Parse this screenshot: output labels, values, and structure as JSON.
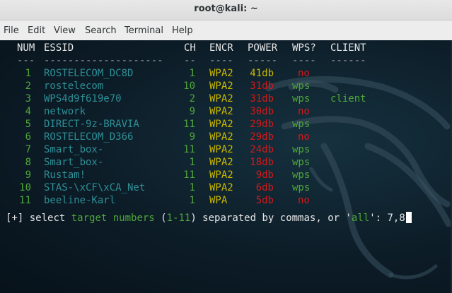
{
  "window": {
    "title": "root@kali: ~"
  },
  "menu": [
    "File",
    "Edit",
    "View",
    "Search",
    "Terminal",
    "Help"
  ],
  "table": {
    "headers": {
      "num": "NUM",
      "essid": "ESSID",
      "ch": "CH",
      "encr": "ENCR",
      "power": "POWER",
      "wps": "WPS?",
      "client": "CLIENT"
    },
    "separators": {
      "num": "---",
      "essid": "--------------------",
      "ch": "--",
      "encr": "----",
      "power": "-----",
      "wps": "----",
      "client": "------"
    },
    "rows": [
      {
        "num": "1",
        "essid": "ROSTELECOM_DC8D",
        "ch": "1",
        "encr": "WPA2",
        "power": "41db",
        "wps": "no",
        "client": ""
      },
      {
        "num": "2",
        "essid": "rostelecom",
        "ch": "10",
        "encr": "WPA2",
        "power": "31db",
        "wps": "wps",
        "client": ""
      },
      {
        "num": "3",
        "essid": "WPS4d9f619e70",
        "ch": "2",
        "encr": "WPA2",
        "power": "31db",
        "wps": "wps",
        "client": "client"
      },
      {
        "num": "4",
        "essid": "network",
        "ch": "9",
        "encr": "WPA2",
        "power": "30db",
        "wps": "no",
        "client": ""
      },
      {
        "num": "5",
        "essid": "DIRECT-9z-BRAVIA",
        "ch": "11",
        "encr": "WPA2",
        "power": "29db",
        "wps": "wps",
        "client": ""
      },
      {
        "num": "6",
        "essid": "ROSTELECOM_D366",
        "ch": "9",
        "encr": "WPA2",
        "power": "29db",
        "wps": "no",
        "client": ""
      },
      {
        "num": "7",
        "essid": "Smart_box-",
        "ch": "11",
        "encr": "WPA2",
        "power": "24db",
        "wps": "wps",
        "client": ""
      },
      {
        "num": "8",
        "essid": "Smart_box-",
        "ch": "1",
        "encr": "WPA2",
        "power": "18db",
        "wps": "wps",
        "client": ""
      },
      {
        "num": "9",
        "essid": "Rustam!",
        "ch": "11",
        "encr": "WPA2",
        "power": "9db",
        "wps": "wps",
        "client": ""
      },
      {
        "num": "10",
        "essid": "STAS-\\xCF\\xCA_Net",
        "ch": "1",
        "encr": "WPA2",
        "power": "6db",
        "wps": "wps",
        "client": ""
      },
      {
        "num": "11",
        "essid": "beeline-Karl",
        "ch": "1",
        "encr": "WPA",
        "power": "5db",
        "wps": "no",
        "client": ""
      }
    ]
  },
  "prompt": {
    "prefix": "[+]",
    "select": " select ",
    "target_numbers": "target numbers",
    "open_paren": " (",
    "range": "1-11",
    "close_text": ") separated by commas, or '",
    "all": "all",
    "end": "': ",
    "input": "7,8"
  },
  "colors": {
    "terminal_bg": "#0c1c27",
    "green": "#4fa63a",
    "cyan": "#2e8f96",
    "yellow": "#c9b800",
    "red": "#d11919",
    "white": "#e6e6e6"
  },
  "icons": [
    "kali-dragon-icon"
  ]
}
